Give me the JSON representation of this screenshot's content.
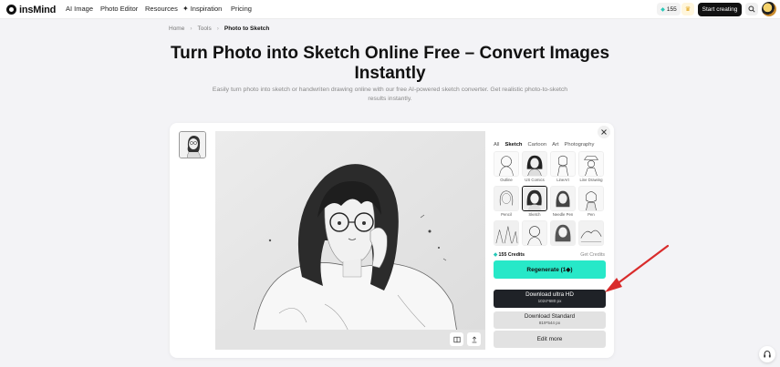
{
  "nav": {
    "logo_text": "insMind",
    "items": [
      "AI Image",
      "Photo Editor",
      "Resources",
      "Inspiration",
      "Pricing"
    ],
    "credits": "155",
    "start_label": "Start creating"
  },
  "breadcrumb": {
    "items": [
      "Home",
      "Tools",
      "Photo to Sketch"
    ]
  },
  "hero": {
    "title": "Turn Photo into Sketch Online Free – Convert Images Instantly",
    "subtitle": "Easily turn photo into sketch or handwriten drawing online with our free AI-powered sketch converter. Get realistic photo-to-sketch results instantly."
  },
  "panel": {
    "tabs": [
      "All",
      "Sketch",
      "Cartoon",
      "Art",
      "Photography"
    ],
    "active_tab": "Sketch",
    "styles": [
      {
        "label": "Outline",
        "selected": false
      },
      {
        "label": "US Comics",
        "selected": false
      },
      {
        "label": "LineArt",
        "selected": false
      },
      {
        "label": "Line Drawing",
        "selected": false
      },
      {
        "label": "Pencil",
        "selected": false
      },
      {
        "label": "Sketch",
        "selected": true
      },
      {
        "label": "Needle Pen",
        "selected": false
      },
      {
        "label": "Pen",
        "selected": false
      },
      {
        "label": "",
        "selected": false
      },
      {
        "label": "",
        "selected": false
      },
      {
        "label": "",
        "selected": false
      },
      {
        "label": "",
        "selected": false
      }
    ],
    "credits_text": "155 Credits",
    "get_credits": "Get Credits",
    "regenerate": "Regenerate (1",
    "download_ultra": {
      "title": "Download ultra HD",
      "size": "1024*680 px"
    },
    "download_standard": {
      "title": "Download Standard",
      "size": "819*544 px"
    },
    "edit_more": "Edit more"
  },
  "colors": {
    "accent": "#27e8c8",
    "dark_button": "#1f2227",
    "arrow": "#d92b2b"
  }
}
